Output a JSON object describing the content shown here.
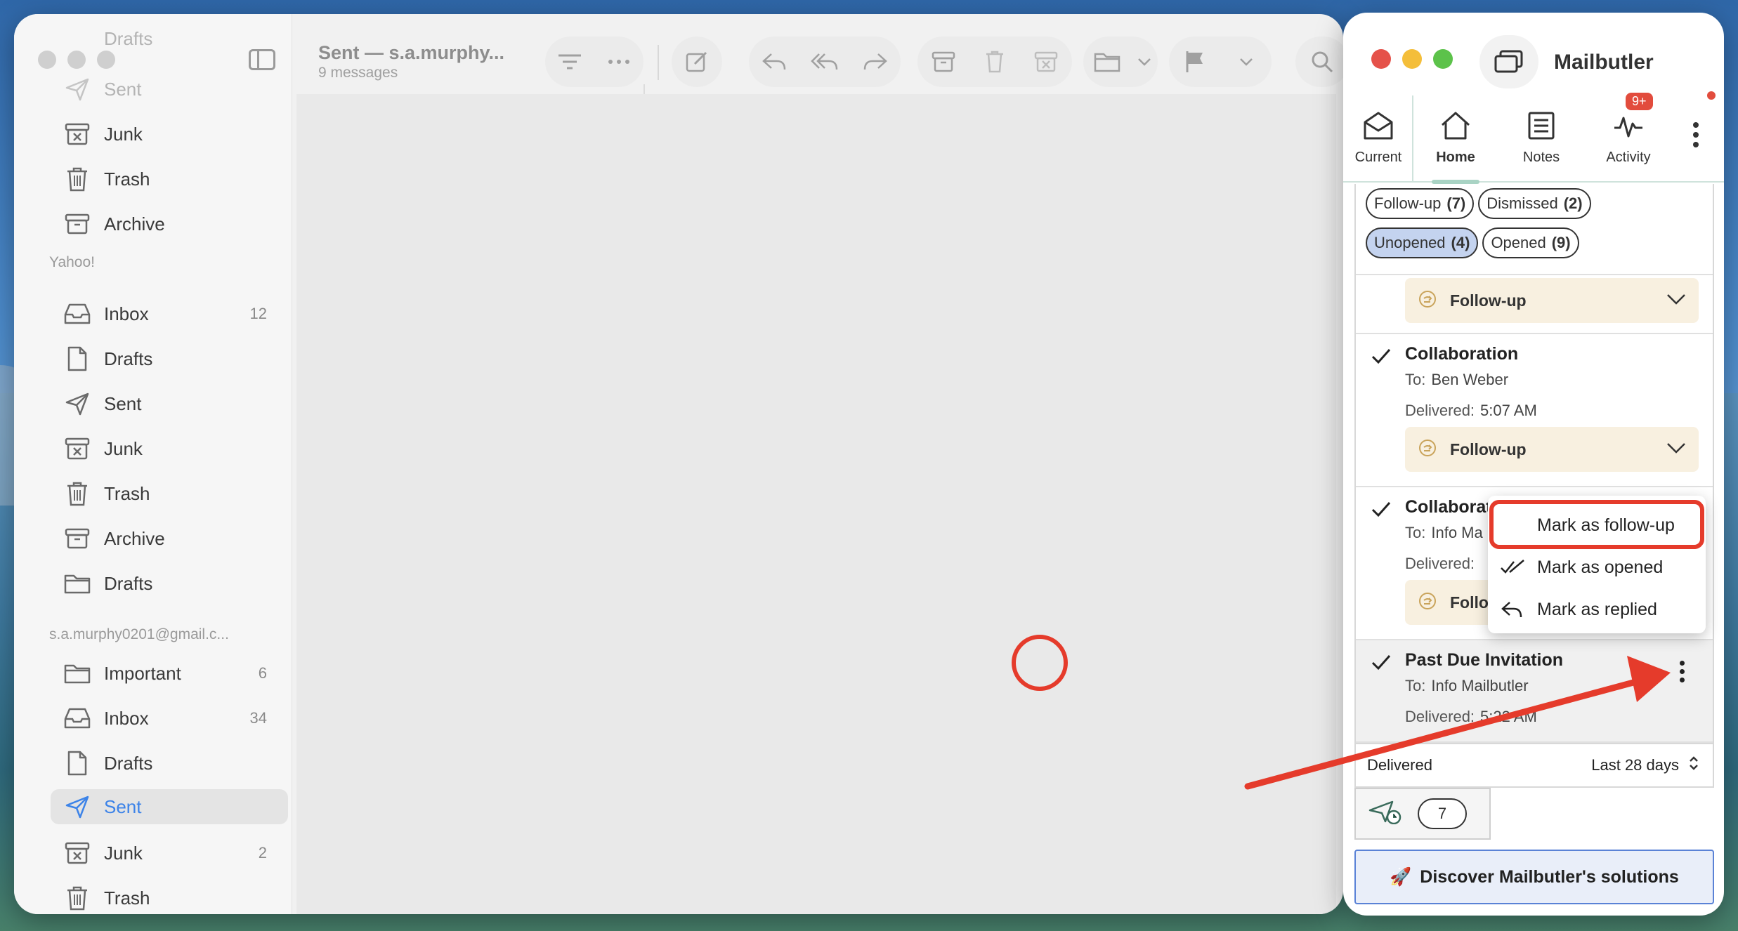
{
  "mail": {
    "sidebar": {
      "top_items": [
        {
          "label": "Drafts",
          "icon": "doc-icon",
          "faded": true
        },
        {
          "label": "Sent",
          "icon": "paperplane-icon",
          "faded": true
        },
        {
          "label": "Junk",
          "icon": "junk-icon"
        },
        {
          "label": "Trash",
          "icon": "trash-icon"
        },
        {
          "label": "Archive",
          "icon": "archive-icon"
        }
      ],
      "yahoo_section": "Yahoo!",
      "yahoo_items": [
        {
          "label": "Inbox",
          "count": "12"
        },
        {
          "label": "Drafts",
          "count": ""
        },
        {
          "label": "Sent",
          "count": ""
        },
        {
          "label": "Junk",
          "count": ""
        },
        {
          "label": "Trash",
          "count": ""
        },
        {
          "label": "Archive",
          "count": ""
        },
        {
          "label": "Drafts",
          "count": ""
        }
      ],
      "gmail_section": "s.a.murphy0201@gmail.c...",
      "gmail_items": [
        {
          "label": "Important",
          "count": "6"
        },
        {
          "label": "Inbox",
          "count": "34"
        },
        {
          "label": "Drafts",
          "count": ""
        },
        {
          "label": "Sent",
          "count": "",
          "selected": true
        },
        {
          "label": "Junk",
          "count": "2"
        },
        {
          "label": "Trash",
          "count": ""
        }
      ]
    },
    "toolbar": {
      "title": "Sent — s.a.murphy...",
      "subtitle": "9 messages"
    }
  },
  "mailbutler": {
    "title": "Mailbutler",
    "tabs": [
      {
        "label": "Current",
        "icon": "envelope-open-icon"
      },
      {
        "label": "Home",
        "icon": "home-icon",
        "active": true
      },
      {
        "label": "Notes",
        "icon": "notes-icon"
      },
      {
        "label": "Activity",
        "icon": "activity-icon",
        "badge": "9+"
      }
    ],
    "chips_row1": [
      {
        "label": "Follow-up",
        "count": "(7)"
      },
      {
        "label": "Dismissed",
        "count": "(2)"
      }
    ],
    "chips_row2": [
      {
        "label": "Unopened",
        "count": "(4)",
        "on": true
      },
      {
        "label": "Opened",
        "count": "(9)"
      }
    ],
    "items": [
      {
        "followup": "Follow-up"
      },
      {
        "subject": "Collaboration",
        "to_label": "To:",
        "to": "Ben Weber",
        "delivered_label": "Delivered:",
        "delivered": "5:07 AM",
        "followup": "Follow-up"
      },
      {
        "subject": "Collaboration",
        "to_label": "To:",
        "to": "Info Ma",
        "delivered_label": "Delivered:",
        "delivered": "",
        "followup": "Follo"
      },
      {
        "subject": "Past Due Invitation",
        "to_label": "To:",
        "to": "Info Mailbutler",
        "delivered_label": "Delivered:",
        "delivered": "5:22 AM"
      }
    ],
    "context_menu": [
      {
        "label": "Mark as follow-up",
        "icon": "",
        "highlighted": true
      },
      {
        "label": "Mark as opened",
        "icon": "double-check-icon"
      },
      {
        "label": "Mark as replied",
        "icon": "reply-icon"
      }
    ],
    "footer": {
      "left": "Delivered",
      "right": "Last 28 days"
    },
    "send_later_count": "7",
    "discover": {
      "emoji": "🚀",
      "label": "Discover Mailbutler's solutions"
    },
    "colors": {
      "accent_red": "#e53b2b",
      "chip_on": "#c4d3ef",
      "followup_bg": "#f8f0e0"
    }
  }
}
